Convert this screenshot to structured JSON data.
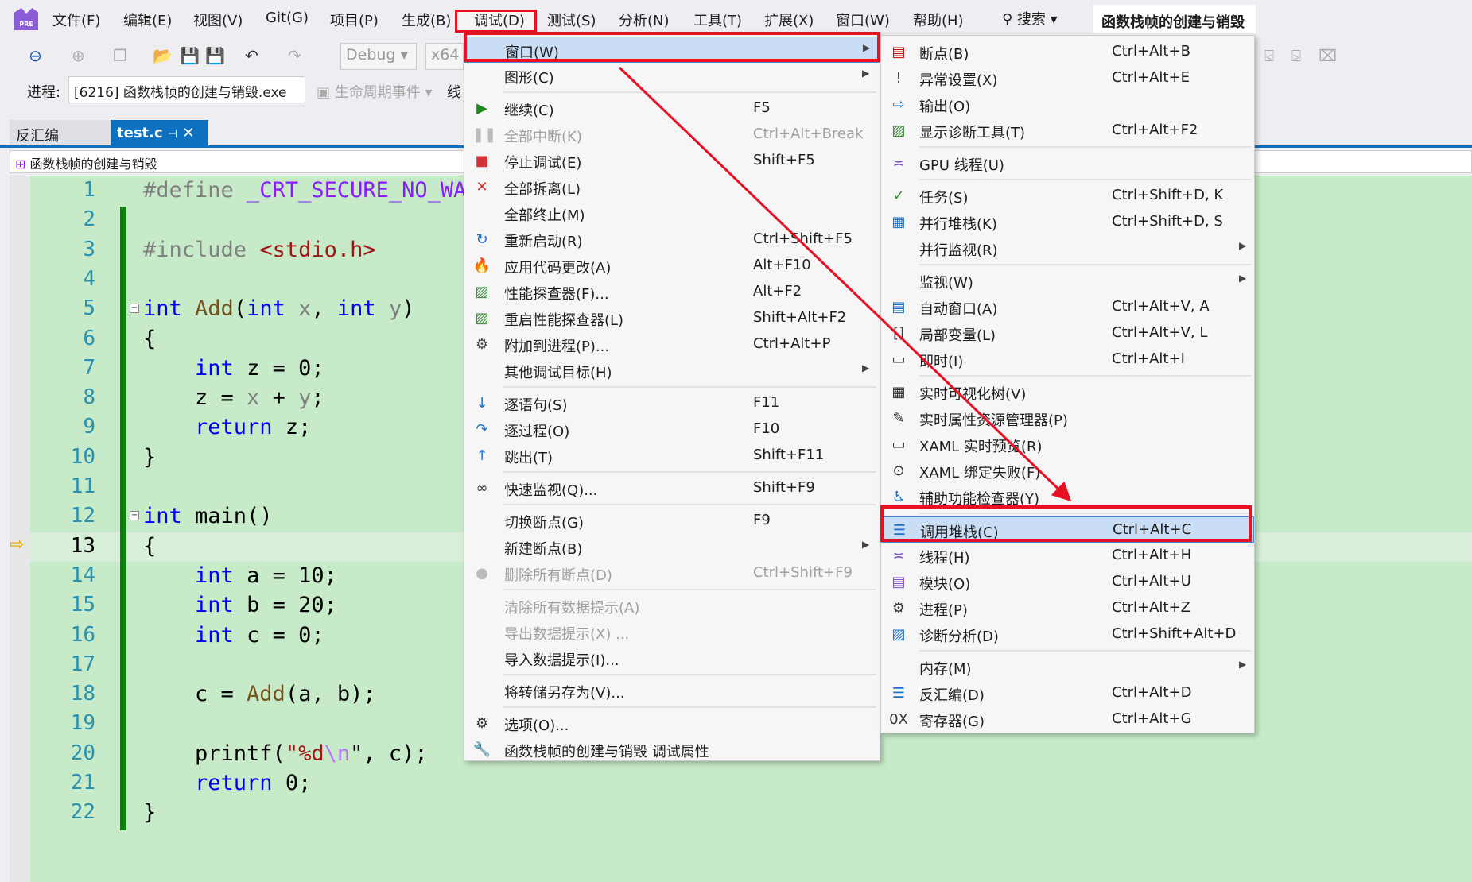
{
  "menubar": {
    "items": [
      "文件(F)",
      "编辑(E)",
      "视图(V)",
      "Git(G)",
      "项目(P)",
      "生成(B)",
      "调试(D)",
      "测试(S)",
      "分析(N)",
      "工具(T)",
      "扩展(X)",
      "窗口(W)",
      "帮助(H)"
    ],
    "search": "搜索",
    "solution_title": "函数栈帧的创建与销毁",
    "logo_text": "PRE"
  },
  "toolbar": {
    "config": "Debug",
    "platform": "x64"
  },
  "process_bar": {
    "label": "进程:",
    "process": "[6216] 函数栈帧的创建与销毁.exe",
    "lifecycle": "生命周期事件",
    "thread": "线"
  },
  "tabs": [
    {
      "label": "反汇编"
    },
    {
      "label": "test.c",
      "active": true
    }
  ],
  "navbar": {
    "scope": "函数栈帧的创建与销毁"
  },
  "editor": {
    "current_line": 13,
    "lines": [
      [
        [
          "#define ",
          "pp"
        ],
        [
          "_CRT_SECURE_NO_WARNINGS",
          "mac"
        ]
      ],
      [],
      [
        [
          "#include ",
          "pp"
        ],
        [
          "<stdio.h>",
          "str"
        ]
      ],
      [],
      [
        [
          "int",
          "kw"
        ],
        [
          " ",
          ""
        ],
        [
          "Add",
          "fn"
        ],
        [
          "(",
          ""
        ],
        [
          "int",
          "kw"
        ],
        [
          " ",
          ""
        ],
        [
          "x",
          "prm"
        ],
        [
          ", ",
          ""
        ],
        [
          "int",
          "kw"
        ],
        [
          " ",
          ""
        ],
        [
          "y",
          "prm"
        ],
        [
          ")",
          ""
        ]
      ],
      [
        [
          "{",
          ""
        ]
      ],
      [
        [
          "    ",
          ""
        ],
        [
          "int",
          "kw"
        ],
        [
          " z = 0;",
          ""
        ]
      ],
      [
        [
          "    z = ",
          ""
        ],
        [
          "x",
          "prm"
        ],
        [
          " + ",
          ""
        ],
        [
          "y",
          "prm"
        ],
        [
          ";",
          ""
        ]
      ],
      [
        [
          "    ",
          ""
        ],
        [
          "return",
          "kw"
        ],
        [
          " z;",
          ""
        ]
      ],
      [
        [
          "}",
          ""
        ]
      ],
      [],
      [
        [
          "int",
          "kw"
        ],
        [
          " main()",
          ""
        ]
      ],
      [
        [
          "{",
          ""
        ]
      ],
      [
        [
          "    ",
          ""
        ],
        [
          "int",
          "kw"
        ],
        [
          " a = 10;",
          ""
        ]
      ],
      [
        [
          "    ",
          ""
        ],
        [
          "int",
          "kw"
        ],
        [
          " b = 20;",
          ""
        ]
      ],
      [
        [
          "    ",
          ""
        ],
        [
          "int",
          "kw"
        ],
        [
          " c = 0;",
          ""
        ]
      ],
      [],
      [
        [
          "    c = ",
          ""
        ],
        [
          "Add",
          "fn"
        ],
        [
          "(a, b);",
          ""
        ]
      ],
      [],
      [
        [
          "    printf(",
          ""
        ],
        [
          "\"%d",
          "str"
        ],
        [
          "\\n",
          "esc"
        ],
        [
          "\"",
          ""
        ],
        [
          ", c);",
          ""
        ]
      ],
      [
        [
          "    ",
          ""
        ],
        [
          "return",
          "kw"
        ],
        [
          " 0;",
          ""
        ]
      ],
      [
        [
          "}",
          ""
        ]
      ]
    ]
  },
  "debug_menu": {
    "items": [
      {
        "label": "窗口(W)",
        "submenu": true,
        "highlighted": true,
        "icon": ""
      },
      {
        "label": "图形(C)",
        "submenu": true,
        "icon": ""
      },
      {
        "sep": true
      },
      {
        "label": "继续(C)",
        "shortcut": "F5",
        "icon": "play-icon"
      },
      {
        "label": "全部中断(K)",
        "shortcut": "Ctrl+Alt+Break",
        "disabled": true,
        "icon": "pause-icon"
      },
      {
        "label": "停止调试(E)",
        "shortcut": "Shift+F5",
        "icon": "stop-icon"
      },
      {
        "label": "全部拆离(L)",
        "icon": "detach-icon"
      },
      {
        "label": "全部终止(M)",
        "icon": ""
      },
      {
        "label": "重新启动(R)",
        "shortcut": "Ctrl+Shift+F5",
        "icon": "restart-icon"
      },
      {
        "label": "应用代码更改(A)",
        "shortcut": "Alt+F10",
        "icon": "hot-reload-icon"
      },
      {
        "label": "性能探查器(F)...",
        "shortcut": "Alt+F2",
        "icon": "profiler-icon"
      },
      {
        "label": "重启性能探查器(L)",
        "shortcut": "Shift+Alt+F2",
        "icon": "profiler-icon"
      },
      {
        "label": "附加到进程(P)...",
        "shortcut": "Ctrl+Alt+P",
        "icon": "gears-icon"
      },
      {
        "label": "其他调试目标(H)",
        "submenu": true,
        "icon": ""
      },
      {
        "sep": true
      },
      {
        "label": "逐语句(S)",
        "shortcut": "F11",
        "icon": "step-into-icon"
      },
      {
        "label": "逐过程(O)",
        "shortcut": "F10",
        "icon": "step-over-icon"
      },
      {
        "label": "跳出(T)",
        "shortcut": "Shift+F11",
        "icon": "step-out-icon"
      },
      {
        "sep": true
      },
      {
        "label": "快速监视(Q)...",
        "shortcut": "Shift+F9",
        "icon": "glasses-icon"
      },
      {
        "sep": true
      },
      {
        "label": "切换断点(G)",
        "shortcut": "F9",
        "icon": ""
      },
      {
        "label": "新建断点(B)",
        "submenu": true,
        "icon": ""
      },
      {
        "label": "删除所有断点(D)",
        "shortcut": "Ctrl+Shift+F9",
        "disabled": true,
        "icon": "delete-breakpoints-icon"
      },
      {
        "sep": true
      },
      {
        "label": "清除所有数据提示(A)",
        "disabled": true,
        "icon": ""
      },
      {
        "label": "导出数据提示(X) ...",
        "disabled": true,
        "icon": ""
      },
      {
        "label": "导入数据提示(I)...",
        "icon": ""
      },
      {
        "sep": true
      },
      {
        "label": "将转储另存为(V)...",
        "icon": ""
      },
      {
        "sep": true
      },
      {
        "label": "选项(O)...",
        "icon": "gear-icon"
      },
      {
        "label": "函数栈帧的创建与销毁 调试属性",
        "icon": "wrench-icon"
      }
    ]
  },
  "window_submenu": {
    "items": [
      {
        "label": "断点(B)",
        "shortcut": "Ctrl+Alt+B",
        "icon": "breakpoints-icon"
      },
      {
        "label": "异常设置(X)",
        "shortcut": "Ctrl+Alt+E",
        "icon": "exception-icon"
      },
      {
        "label": "输出(O)",
        "icon": "output-icon"
      },
      {
        "label": "显示诊断工具(T)",
        "shortcut": "Ctrl+Alt+F2",
        "icon": "diagnostics-icon"
      },
      {
        "sep": true
      },
      {
        "label": "GPU 线程(U)",
        "icon": "gpu-threads-icon"
      },
      {
        "sep": true
      },
      {
        "label": "任务(S)",
        "shortcut": "Ctrl+Shift+D, K",
        "icon": "tasks-icon"
      },
      {
        "label": "并行堆栈(K)",
        "shortcut": "Ctrl+Shift+D, S",
        "icon": "parallel-stacks-icon"
      },
      {
        "label": "并行监视(R)",
        "submenu": true,
        "icon": ""
      },
      {
        "sep": true
      },
      {
        "label": "监视(W)",
        "submenu": true,
        "icon": ""
      },
      {
        "label": "自动窗口(A)",
        "shortcut": "Ctrl+Alt+V, A",
        "icon": "autos-icon"
      },
      {
        "label": "局部变量(L)",
        "shortcut": "Ctrl+Alt+V, L",
        "icon": "locals-icon"
      },
      {
        "label": "即时(I)",
        "shortcut": "Ctrl+Alt+I",
        "icon": "immediate-icon"
      },
      {
        "sep": true
      },
      {
        "label": "实时可视化树(V)",
        "icon": "visual-tree-icon"
      },
      {
        "label": "实时属性资源管理器(P)",
        "icon": "property-explorer-icon"
      },
      {
        "label": "XAML 实时预览(R)",
        "icon": "xaml-preview-icon"
      },
      {
        "label": "XAML 绑定失败(F)",
        "icon": "xaml-binding-icon"
      },
      {
        "label": "辅助功能检查器(Y)",
        "icon": "accessibility-icon"
      },
      {
        "sep": true
      },
      {
        "label": "调用堆栈(C)",
        "shortcut": "Ctrl+Alt+C",
        "highlighted": true,
        "icon": "call-stack-icon"
      },
      {
        "label": "线程(H)",
        "shortcut": "Ctrl+Alt+H",
        "icon": "threads-icon"
      },
      {
        "label": "模块(O)",
        "shortcut": "Ctrl+Alt+U",
        "icon": "modules-icon"
      },
      {
        "label": "进程(P)",
        "shortcut": "Ctrl+Alt+Z",
        "icon": "processes-icon"
      },
      {
        "label": "诊断分析(D)",
        "shortcut": "Ctrl+Shift+Alt+D",
        "icon": "diagnostic-analysis-icon"
      },
      {
        "sep": true
      },
      {
        "label": "内存(M)",
        "submenu": true,
        "icon": ""
      },
      {
        "label": "反汇编(D)",
        "shortcut": "Ctrl+Alt+D",
        "icon": "disassembly-icon"
      },
      {
        "label": "寄存器(G)",
        "shortcut": "Ctrl+Alt+G",
        "icon": "registers-icon"
      }
    ]
  },
  "colors": {
    "annotation": "#e81123",
    "accent": "#0e70c0",
    "editor_bg": "#c7ebc9",
    "highlight": "#c9def5"
  }
}
